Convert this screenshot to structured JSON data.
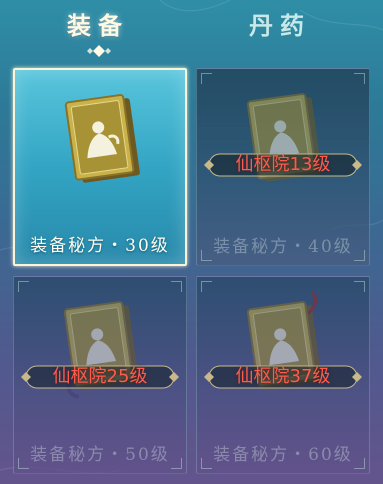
{
  "tabs": [
    {
      "label": "装备",
      "active": true
    },
    {
      "label": "丹药",
      "active": false
    }
  ],
  "cards": [
    {
      "label": "装备秘方・30级",
      "locked": false,
      "lock_text": ""
    },
    {
      "label": "装备秘方・40级",
      "locked": true,
      "lock_text": "仙枢院13级"
    },
    {
      "label": "装备秘方・50级",
      "locked": true,
      "lock_text": "仙枢院25级"
    },
    {
      "label": "装备秘方・60级",
      "locked": true,
      "lock_text": "仙枢院37级"
    }
  ],
  "colors": {
    "lock_text": "#ff5a4c",
    "selected_border": "#fbf4d8",
    "book_gold": "#c9b24a"
  },
  "icons": {
    "book": "recipe-book-icon",
    "tab_ornament": "diamond-ornament-icon"
  }
}
